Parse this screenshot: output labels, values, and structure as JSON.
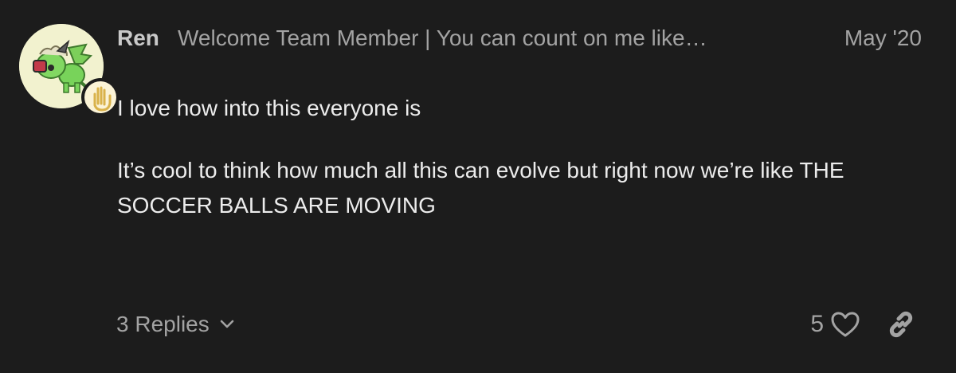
{
  "post": {
    "username": "Ren",
    "user_title": "Welcome Team Member | You can count on me like…",
    "date": "May '20",
    "avatar_icon": "green-creature-avatar-icon",
    "flair_icon": "raised-hand-flair-icon",
    "paragraphs": [
      "I love how into this everyone is",
      "It’s cool to think how much all this can evolve but right now we’re like THE SOCCER BALLS ARE MOVING"
    ]
  },
  "footer": {
    "replies_label": "3 Replies",
    "like_count": "5",
    "icons": {
      "replies_toggle": "chevron-down-icon",
      "like": "heart-icon",
      "share": "link-icon"
    }
  },
  "colors": {
    "background": "#1c1c1c",
    "text_primary": "#ececec",
    "text_muted": "#a3a3a3",
    "avatar_bg": "#f2f2cf",
    "flair_gold": "#d9b24a"
  }
}
